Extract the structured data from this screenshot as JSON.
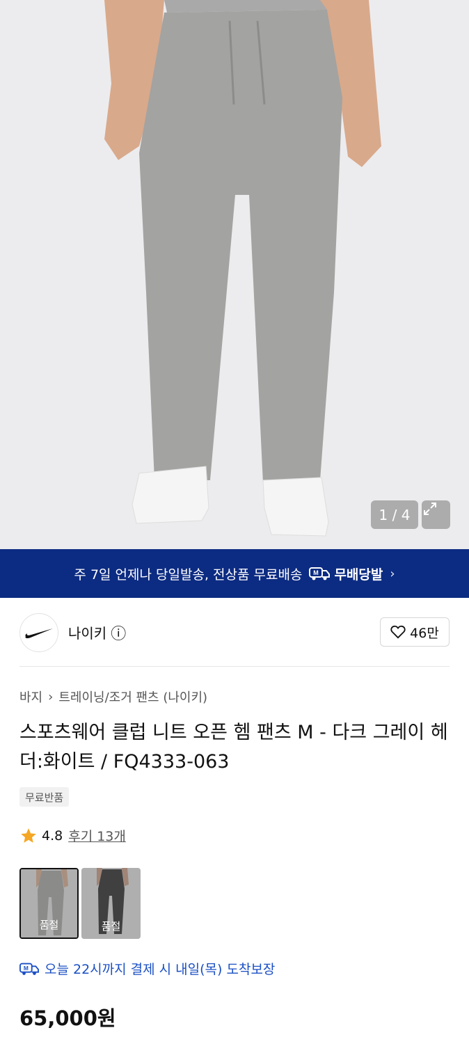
{
  "hero": {
    "pager": "1 / 4",
    "expand_icon": "expand-icon"
  },
  "banner": {
    "text": "주 7일 언제나 당일발송, 전상품 무료배송",
    "badge_label": "무배당발",
    "chevron": "›"
  },
  "brand": {
    "name": "나이키",
    "info_icon": "ⓘ",
    "likes": "46만"
  },
  "breadcrumb": {
    "level1": "바지",
    "separator": "›",
    "level2": "트레이닝/조거 팬츠 (나이키)"
  },
  "product": {
    "title": "스포츠웨어 클럽 니트 오픈 헴 팬츠 M - 다크 그레이 헤더:화이트 / FQ4333-063",
    "tag": "무료반품",
    "rating": "4.8",
    "reviews": "후기 13개",
    "options": [
      {
        "label": "품절",
        "color": "gray"
      },
      {
        "label": "품절",
        "color": "black"
      }
    ],
    "delivery": "오늘 22시까지 결제 시 내일(목) 도착보장",
    "price": "65,000원"
  },
  "colors": {
    "banner_bg": "#0c2b82",
    "delivery_text": "#1a4fc4",
    "star": "#f5a623"
  }
}
